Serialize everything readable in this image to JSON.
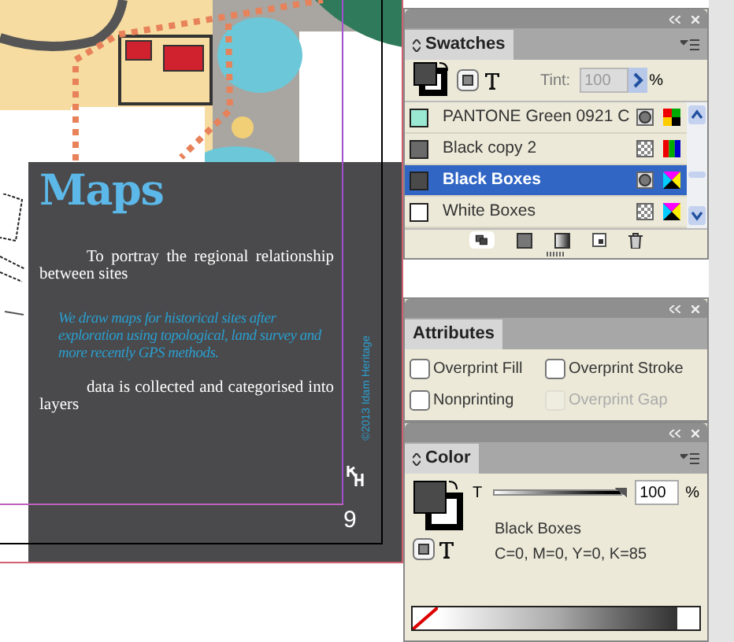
{
  "document": {
    "heading": "Maps",
    "paragraphs": [
      {
        "kind": "body",
        "text": "To portray the regional relationship between sites"
      },
      {
        "kind": "quote",
        "text": "We draw maps for historical sites after exploration using topological, land survey and more recently GPS methods."
      },
      {
        "kind": "body",
        "text": "data is collected and categorised into layers"
      }
    ],
    "credit": "©2013 Idam Heritage",
    "page_number": "9"
  },
  "swatches_panel": {
    "title": "Swatches",
    "tint_label": "Tint:",
    "tint_value": "100",
    "percent": "%",
    "swatches": [
      {
        "name": "PANTONE Green 0921 C",
        "color": "#9be8d2",
        "spot": true,
        "kind": "lab",
        "selected": false
      },
      {
        "name": "Black copy 2",
        "color": "#6a6a6a",
        "spot": false,
        "kind": "rgb",
        "selected": false
      },
      {
        "name": "Black Boxes",
        "color": "#4a4a4a",
        "spot": true,
        "kind": "cmyk",
        "selected": true
      },
      {
        "name": "White Boxes",
        "color": "#ffffff",
        "spot": false,
        "kind": "cmyk",
        "selected": false
      }
    ]
  },
  "attributes_panel": {
    "title": "Attributes",
    "options": [
      {
        "label": "Overprint Fill",
        "checked": false,
        "disabled": false
      },
      {
        "label": "Overprint Stroke",
        "checked": false,
        "disabled": false
      },
      {
        "label": "Nonprinting",
        "checked": false,
        "disabled": false
      },
      {
        "label": "Overprint Gap",
        "checked": false,
        "disabled": true
      }
    ]
  },
  "color_panel": {
    "title": "Color",
    "slider_label": "T",
    "level": 1,
    "value": "100",
    "percent": "%",
    "swatch_name": "Black Boxes",
    "values": "C=0, M=0, Y=0, K=85"
  }
}
